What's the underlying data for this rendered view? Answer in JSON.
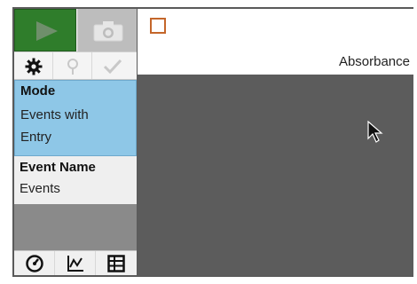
{
  "sidebar": {
    "mode_title": "Mode",
    "mode_value_line1": "Events with",
    "mode_value_line2": "Entry",
    "event_name_title": "Event Name",
    "event_name_value": "Events",
    "start_icon": "play-icon",
    "camera_icon": "camera-icon",
    "tools": [
      "gear-icon",
      "marker-pin-icon",
      "checkmark-icon"
    ],
    "views": [
      "meter-icon",
      "graph-icon",
      "table-icon"
    ]
  },
  "main": {
    "column_label": "Absorbance",
    "marker_color": "#c4662a"
  },
  "colors": {
    "start_green": "#2f7d2b",
    "mode_blue": "#8ec7e7",
    "panel_gray": "#5c5c5c"
  }
}
